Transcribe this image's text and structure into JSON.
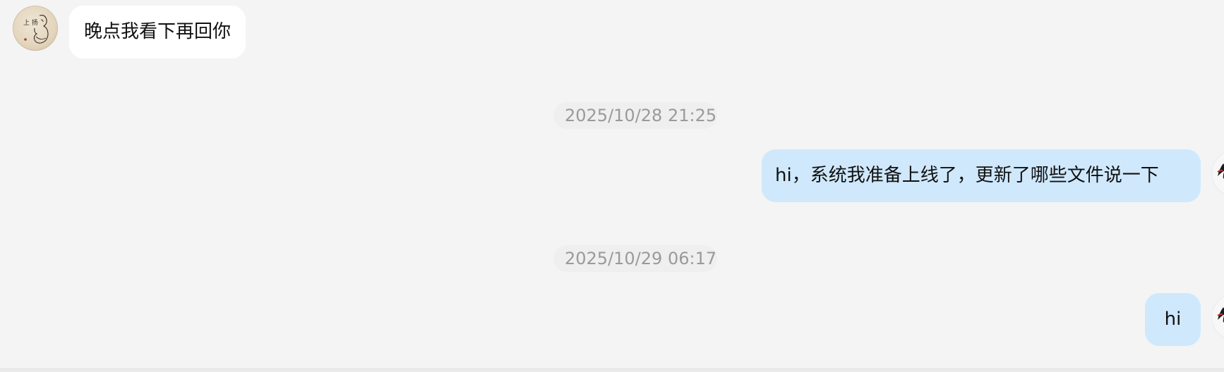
{
  "messages": [
    {
      "direction": "incoming",
      "text": "晚点我看下再回你",
      "avatar_icon": "ink-sketch-avatar-icon",
      "avatar_text": "上 扬"
    },
    {
      "direction": "outgoing",
      "timestamp": "2025/10/28 21:25",
      "text": "hi，系统我准备上线了，更新了哪些文件说一下",
      "avatar_icon": "user-avatar-icon"
    },
    {
      "direction": "outgoing",
      "timestamp": "2025/10/29 06:17",
      "text": "hi",
      "avatar_icon": "user-avatar-icon"
    }
  ],
  "colors": {
    "background": "#f4f4f4",
    "incoming_bubble": "#ffffff",
    "outgoing_bubble": "#cfe8fc",
    "timestamp_text": "#9a9a9a",
    "message_text": "#111111"
  }
}
